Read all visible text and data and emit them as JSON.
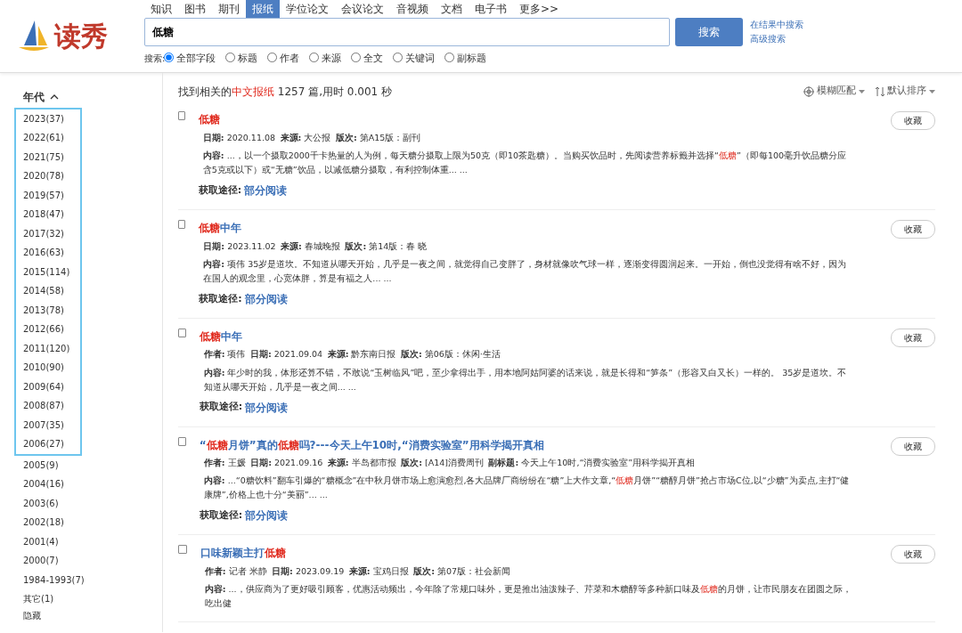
{
  "logo": {
    "text": "读秀"
  },
  "nav_tabs": [
    {
      "label": "知识",
      "selected": false
    },
    {
      "label": "图书",
      "selected": false
    },
    {
      "label": "期刊",
      "selected": false
    },
    {
      "label": "报纸",
      "selected": true
    },
    {
      "label": "学位论文",
      "selected": false
    },
    {
      "label": "会议论文",
      "selected": false
    },
    {
      "label": "音视频",
      "selected": false
    },
    {
      "label": "文档",
      "selected": false
    },
    {
      "label": "电子书",
      "selected": false
    },
    {
      "label": "更多>>",
      "selected": false
    }
  ],
  "search": {
    "value": "低糖",
    "button": "搜索",
    "links": [
      "在结果中搜索",
      "高级搜索"
    ]
  },
  "search_fields": {
    "label": "搜索:",
    "options": [
      {
        "label": "全部字段",
        "selected": true
      },
      {
        "label": "标题",
        "selected": false
      },
      {
        "label": "作者",
        "selected": false
      },
      {
        "label": "来源",
        "selected": false
      },
      {
        "label": "全文",
        "selected": false
      },
      {
        "label": "关键词",
        "selected": false
      },
      {
        "label": "副标题",
        "selected": false
      }
    ]
  },
  "sidebar": {
    "heading": "年代",
    "expanded": true,
    "items": [
      {
        "label": "2023(37)",
        "highlighted": true
      },
      {
        "label": "2022(61)",
        "highlighted": true
      },
      {
        "label": "2021(75)",
        "highlighted": true
      },
      {
        "label": "2020(78)",
        "highlighted": true
      },
      {
        "label": "2019(57)",
        "highlighted": true
      },
      {
        "label": "2018(47)",
        "highlighted": true
      },
      {
        "label": "2017(32)",
        "highlighted": true
      },
      {
        "label": "2016(63)",
        "highlighted": true
      },
      {
        "label": "2015(114)",
        "highlighted": true
      },
      {
        "label": "2014(58)",
        "highlighted": true
      },
      {
        "label": "2013(78)",
        "highlighted": true
      },
      {
        "label": "2012(66)",
        "highlighted": true
      },
      {
        "label": "2011(120)",
        "highlighted": true
      },
      {
        "label": "2010(90)",
        "highlighted": true
      },
      {
        "label": "2009(64)",
        "highlighted": true
      },
      {
        "label": "2008(87)",
        "highlighted": true
      },
      {
        "label": "2007(35)",
        "highlighted": true
      },
      {
        "label": "2006(27)",
        "highlighted": true
      },
      {
        "label": "2005(9)",
        "highlighted": false
      },
      {
        "label": "2004(16)",
        "highlighted": false
      },
      {
        "label": "2003(6)",
        "highlighted": false
      },
      {
        "label": "2002(18)",
        "highlighted": false
      },
      {
        "label": "2001(4)",
        "highlighted": false
      },
      {
        "label": "2000(7)",
        "highlighted": false
      },
      {
        "label": "1984-1993(7)",
        "highlighted": false
      },
      {
        "label": "其它(1)",
        "highlighted": false
      }
    ],
    "hide": "隐藏"
  },
  "summary": [
    {
      "text": "找到相关的",
      "hit": false
    },
    {
      "text": "中文报纸",
      "hit": true
    },
    {
      "text": " 1257 篇,用时 0.001 秒",
      "hit": false
    }
  ],
  "tools": [
    "模糊匹配",
    "默认排序"
  ],
  "results": [
    {
      "checked": false,
      "title": [
        {
          "text": "低糖",
          "hit": true
        }
      ],
      "meta": [
        {
          "label": "日期:",
          "value": "2020.11.08"
        },
        {
          "label": "来源:",
          "value": "大公报"
        },
        {
          "label": "版次:",
          "value": "第A15版：副刊"
        }
      ],
      "content": {
        "label": "内容:",
        "segments": [
          {
            "text": " ...，以一个摄取2000千卡热量的人为例，每天糖分摄取上限为50克（即10茶匙糖）。当购买饮品时，先阅读营养标籤并选择“",
            "hit": false
          },
          {
            "text": "低糖",
            "hit": true
          },
          {
            "text": "”（即每100毫升饮品糖分应含5克或以下）或“无糖”饮品，以减低糖分摄取，有利控制体重... ...",
            "hit": false
          }
        ]
      },
      "access": {
        "label": "获取途径:",
        "link": "部分阅读"
      },
      "collect": "收藏"
    },
    {
      "checked": false,
      "title": [
        {
          "text": "低糖",
          "hit": true
        },
        {
          "text": "中年",
          "hit": false
        }
      ],
      "meta": [
        {
          "label": "日期:",
          "value": "2023.11.02"
        },
        {
          "label": "来源:",
          "value": "春城晚报"
        },
        {
          "label": "版次:",
          "value": "第14版：春 晓"
        }
      ],
      "content": {
        "label": "内容:",
        "segments": [
          {
            "text": " 项伟 35岁是道坎。不知道从哪天开始，几乎是一夜之间，就觉得自己变胖了，身材就像吹气球一样，逐渐变得圆润起来。一开始，倒也没觉得有啥不好，因为在国人的观念里，心宽体胖，算是有福之人... ...",
            "hit": false
          }
        ]
      },
      "access": {
        "label": "获取途径:",
        "link": "部分阅读"
      },
      "collect": "收藏"
    },
    {
      "checked": false,
      "title": [
        {
          "text": "低糖",
          "hit": true
        },
        {
          "text": "中年",
          "hit": false
        }
      ],
      "meta": [
        {
          "label": "作者:",
          "value": "项伟"
        },
        {
          "label": "日期:",
          "value": "2021.09.04"
        },
        {
          "label": "来源:",
          "value": "黔东南日报"
        },
        {
          "label": "版次:",
          "value": "第06版：休闲·生活"
        }
      ],
      "content": {
        "label": "内容:",
        "segments": [
          {
            "text": " 年少时的我，体形还算不错，不敢说“玉树临风”吧，至少拿得出手，用本地阿姑阿婆的话来说，就是长得和“笋条”（形容又白又长）一样的。 35岁是道坎。不知道从哪天开始，几乎是一夜之间... ...",
            "hit": false
          }
        ]
      },
      "access": {
        "label": "获取途径:",
        "link": "部分阅读"
      },
      "collect": "收藏"
    },
    {
      "checked": false,
      "title": [
        {
          "text": "“",
          "hit": false
        },
        {
          "text": "低糖",
          "hit": true
        },
        {
          "text": "月饼”真的",
          "hit": false
        },
        {
          "text": "低糖",
          "hit": true
        },
        {
          "text": "吗?---今天上午10时,“消费实验室”用科学揭开真相",
          "hit": false
        }
      ],
      "meta": [
        {
          "label": "作者:",
          "value": "王媛"
        },
        {
          "label": "日期:",
          "value": "2021.09.16"
        },
        {
          "label": "来源:",
          "value": "半岛都市报"
        },
        {
          "label": "版次:",
          "value": "[A14]消费周刊"
        },
        {
          "label": "副标题:",
          "value": "今天上午10时,“消费实验室”用科学揭开真相"
        }
      ],
      "content": {
        "label": "内容:",
        "segments": [
          {
            "text": " ...“0糖饮料”翻车引爆的“糖概念”在中秋月饼市场上愈演愈烈,各大品牌厂商纷纷在“糖”上大作文章,“",
            "hit": false
          },
          {
            "text": "低糖",
            "hit": true
          },
          {
            "text": "月饼”“糖醇月饼”抢占市场C位,以“少糖”为卖点,主打“健康牌”,价格上也十分“美丽”... ...",
            "hit": false
          }
        ]
      },
      "access": {
        "label": "获取途径:",
        "link": "部分阅读"
      },
      "collect": "收藏"
    },
    {
      "checked": false,
      "title": [
        {
          "text": "口味新颖主打",
          "hit": false
        },
        {
          "text": "低糖",
          "hit": true
        }
      ],
      "meta": [
        {
          "label": "作者:",
          "value": "记者 米静"
        },
        {
          "label": "日期:",
          "value": "2023.09.19"
        },
        {
          "label": "来源:",
          "value": "宝鸡日报"
        },
        {
          "label": "版次:",
          "value": "第07版：社会新闻"
        }
      ],
      "content": {
        "label": "内容:",
        "segments": [
          {
            "text": " ...，供应商为了更好吸引顾客，优惠活动频出，今年除了常规口味外，更是推出油泼辣子、芹菜和木糖醇等多种新口味及",
            "hit": false
          },
          {
            "text": "低糖",
            "hit": true
          },
          {
            "text": "的月饼，让市民朋友在团圆之际，吃出健",
            "hit": false
          }
        ]
      },
      "collect": "收藏"
    }
  ]
}
